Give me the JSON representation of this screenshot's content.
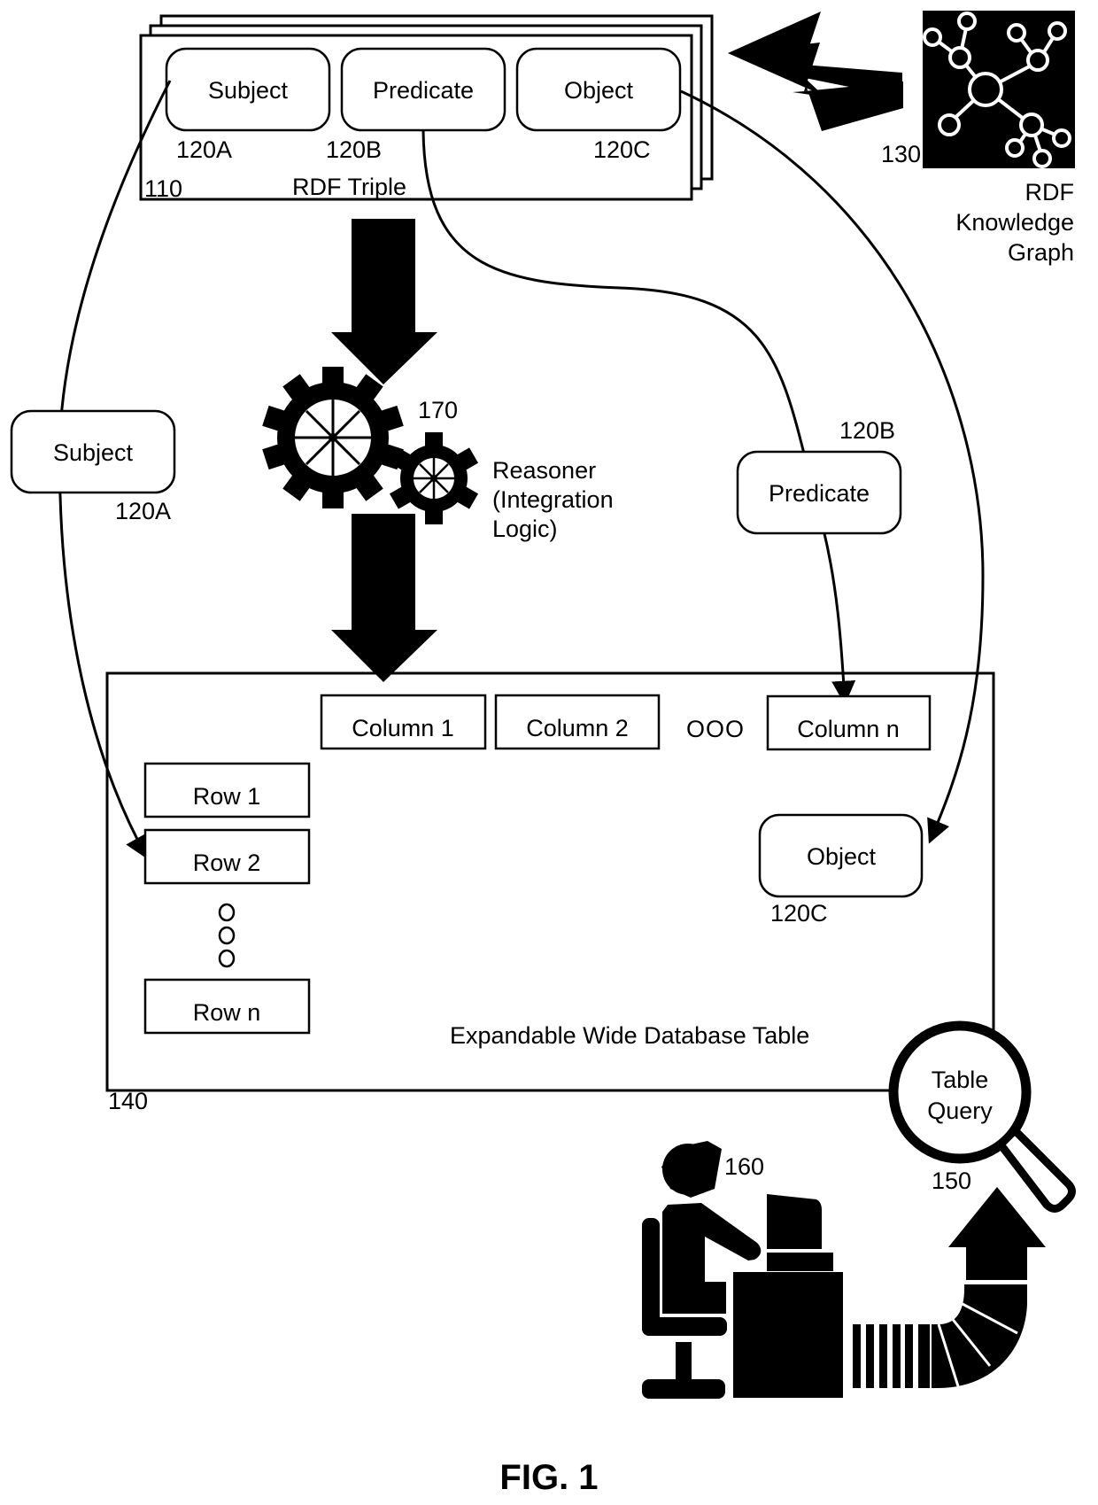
{
  "figure": {
    "caption": "FIG. 1",
    "colors": {
      "ink": "#000000",
      "paper": "#ffffff"
    }
  },
  "rdf_triple": {
    "ref": "110",
    "label": "RDF Triple",
    "subject": {
      "label": "Subject",
      "ref": "120A"
    },
    "predicate": {
      "label": "Predicate",
      "ref": "120B"
    },
    "object": {
      "label": "Object",
      "ref": "120C"
    }
  },
  "knowledge_graph": {
    "ref": "130",
    "label_lines": [
      "RDF",
      "Knowledge",
      "Graph"
    ],
    "icon": "network-graph-icon"
  },
  "reasoner": {
    "ref": "170",
    "label_lines": [
      "Reasoner",
      "(Integration",
      "Logic)"
    ],
    "icon": "gears-icon"
  },
  "floating_elements": {
    "subject": {
      "label": "Subject",
      "ref": "120A"
    },
    "predicate": {
      "label": "Predicate",
      "ref": "120B"
    }
  },
  "database_table": {
    "ref": "140",
    "label": "Expandable Wide Database Table",
    "columns": [
      "Column 1",
      "Column 2",
      "Column n"
    ],
    "column_ellipsis": "OOO",
    "rows": [
      "Row 1",
      "Row 2",
      "Row n"
    ],
    "object": {
      "label": "Object",
      "ref": "120C"
    }
  },
  "table_query": {
    "ref": "150",
    "label_lines": [
      "Table",
      "Query"
    ],
    "icon": "magnifier-icon"
  },
  "user": {
    "ref": "160",
    "icon": "user-at-computer-icon"
  }
}
